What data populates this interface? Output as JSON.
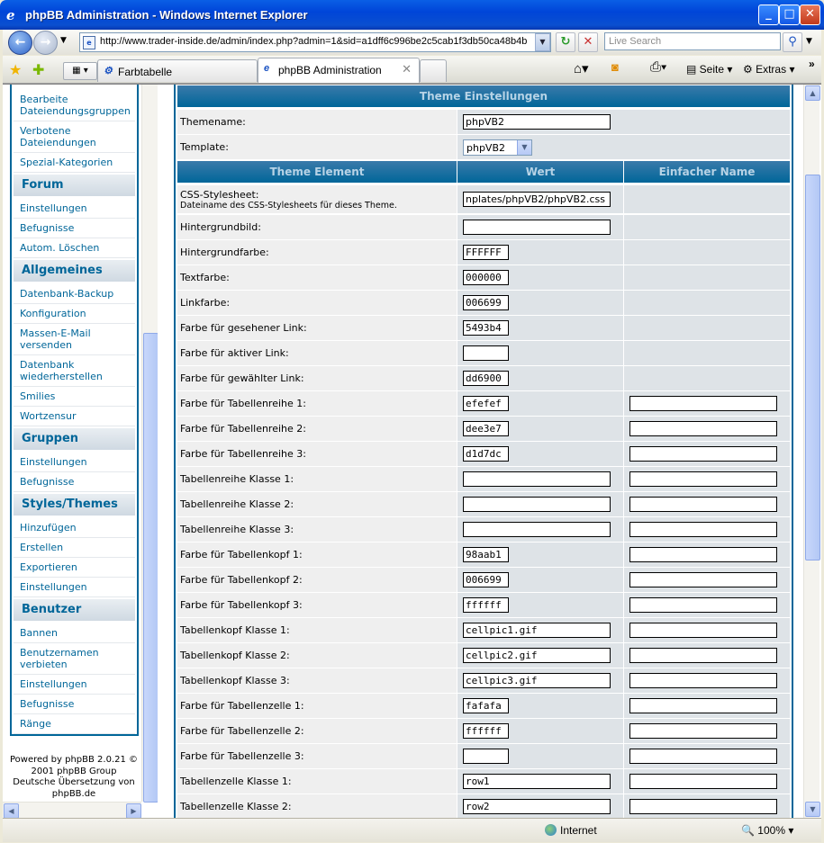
{
  "window": {
    "title": "phpBB Administration - Windows Internet Explorer"
  },
  "nav": {
    "url": "http://www.trader-inside.de/admin/index.php?admin=1&sid=a1dff6c996be2c5cab1f3db50ca48b4b",
    "search_placeholder": "Live Search"
  },
  "tabs": [
    {
      "label": "Farbtabelle"
    },
    {
      "label": "phpBB Administration"
    }
  ],
  "commandbar": {
    "page": "Seite",
    "tools": "Extras"
  },
  "sidebar": {
    "top_links": [
      "Bearbeite Dateiendungsgruppen",
      "Verbotene Dateiendungen",
      "Spezial-Kategorien"
    ],
    "categories": [
      {
        "title": "Forum",
        "items": [
          "Einstellungen",
          "Befugnisse",
          "Autom. Löschen"
        ]
      },
      {
        "title": "Allgemeines",
        "items": [
          "Datenbank-Backup",
          "Konfiguration",
          "Massen-E-Mail versenden",
          "Datenbank wiederherstellen",
          "Smilies",
          "Wortzensur"
        ]
      },
      {
        "title": "Gruppen",
        "items": [
          "Einstellungen",
          "Befugnisse"
        ]
      },
      {
        "title": "Styles/Themes",
        "items": [
          "Hinzufügen",
          "Erstellen",
          "Exportieren",
          "Einstellungen"
        ]
      },
      {
        "title": "Benutzer",
        "items": [
          "Bannen",
          "Benutzernamen verbieten",
          "Einstellungen",
          "Befugnisse",
          "Ränge"
        ]
      }
    ],
    "powered_by": [
      "Powered by phpBB 2.0.21 ©",
      "2001 phpBB Group",
      "Deutsche Übersetzung von",
      "phpBB.de"
    ]
  },
  "main": {
    "header": "Theme Einstellungen",
    "themename_label": "Themename:",
    "themename_value": "phpVB2",
    "template_label": "Template:",
    "template_value": "phpVB2",
    "columns": [
      "Theme Element",
      "Wert",
      "Einfacher Name"
    ],
    "css_label": "CSS-Stylesheet:",
    "css_desc": "Dateiname des CSS-Stylesheets für dieses Theme.",
    "css_value": "nplates/phpVB2/phpVB2.css",
    "rows": [
      {
        "label": "Hintergrundbild:",
        "value": "",
        "width": "wide",
        "simple": null
      },
      {
        "label": "Hintergrundfarbe:",
        "value": "FFFFFF",
        "width": "short",
        "simple": null
      },
      {
        "label": "Textfarbe:",
        "value": "000000",
        "width": "short",
        "simple": null
      },
      {
        "label": "Linkfarbe:",
        "value": "006699",
        "width": "short",
        "simple": null
      },
      {
        "label": "Farbe für gesehener Link:",
        "value": "5493b4",
        "width": "short",
        "simple": null
      },
      {
        "label": "Farbe für aktiver Link:",
        "value": "",
        "width": "short",
        "simple": null
      },
      {
        "label": "Farbe für gewählter Link:",
        "value": "dd6900",
        "width": "short",
        "simple": null
      },
      {
        "label": "Farbe für Tabellenreihe 1:",
        "value": "efefef",
        "width": "short",
        "simple": ""
      },
      {
        "label": "Farbe für Tabellenreihe 2:",
        "value": "dee3e7",
        "width": "short",
        "simple": ""
      },
      {
        "label": "Farbe für Tabellenreihe 3:",
        "value": "d1d7dc",
        "width": "short",
        "simple": ""
      },
      {
        "label": "Tabellenreihe Klasse 1:",
        "value": "",
        "width": "wide",
        "simple": ""
      },
      {
        "label": "Tabellenreihe Klasse 2:",
        "value": "",
        "width": "wide",
        "simple": ""
      },
      {
        "label": "Tabellenreihe Klasse 3:",
        "value": "",
        "width": "wide",
        "simple": ""
      },
      {
        "label": "Farbe für Tabellenkopf 1:",
        "value": "98aab1",
        "width": "short",
        "simple": ""
      },
      {
        "label": "Farbe für Tabellenkopf 2:",
        "value": "006699",
        "width": "short",
        "simple": ""
      },
      {
        "label": "Farbe für Tabellenkopf 3:",
        "value": "ffffff",
        "width": "short",
        "simple": ""
      },
      {
        "label": "Tabellenkopf Klasse 1:",
        "value": "cellpic1.gif",
        "width": "wide",
        "simple": ""
      },
      {
        "label": "Tabellenkopf Klasse 2:",
        "value": "cellpic2.gif",
        "width": "wide",
        "simple": ""
      },
      {
        "label": "Tabellenkopf Klasse 3:",
        "value": "cellpic3.gif",
        "width": "wide",
        "simple": ""
      },
      {
        "label": "Farbe für Tabellenzelle 1:",
        "value": "fafafa",
        "width": "short",
        "simple": ""
      },
      {
        "label": "Farbe für Tabellenzelle 2:",
        "value": "ffffff",
        "width": "short",
        "simple": ""
      },
      {
        "label": "Farbe für Tabellenzelle 3:",
        "value": "",
        "width": "short",
        "simple": ""
      },
      {
        "label": "Tabellenzelle Klasse 1:",
        "value": "row1",
        "width": "wide",
        "simple": ""
      },
      {
        "label": "Tabellenzelle Klasse 2:",
        "value": "row2",
        "width": "wide",
        "simple": ""
      }
    ]
  },
  "statusbar": {
    "zone": "Internet",
    "zoom": "100%"
  },
  "colors": {
    "accent": "#006699",
    "row_light": "#efefef",
    "row_dark": "#dee3e7"
  }
}
